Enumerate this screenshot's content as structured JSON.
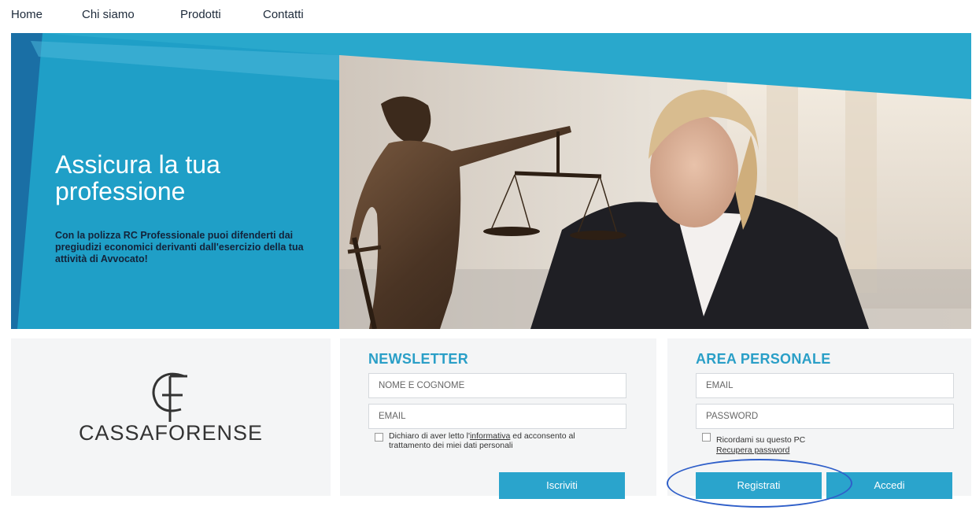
{
  "nav": {
    "home": "Home",
    "about": "Chi siamo",
    "products": "Prodotti",
    "contacts": "Contatti"
  },
  "hero": {
    "title": "Assicura la tua professione",
    "subtitle": "Con la polizza RC Professionale puoi difenderti dai pregiudizi economici derivanti dall'esercizio della tua attività di Avvocato!"
  },
  "logo": {
    "mark": "CF",
    "name": "CASSAFORENSE"
  },
  "newsletter": {
    "title": "NEWSLETTER",
    "name_placeholder": "NOME E COGNOME",
    "email_placeholder": "EMAIL",
    "consent_before": "Dichiaro di aver letto l'",
    "consent_link": "informativa",
    "consent_after": " ed acconsento al trattamento dei miei dati personali",
    "submit": "Iscriviti"
  },
  "personal_area": {
    "title": "AREA PERSONALE",
    "email_placeholder": "EMAIL",
    "password_placeholder": "PASSWORD",
    "remember": "Ricordami su questo PC",
    "recover": "Recupera password",
    "register": "Registrati",
    "login": "Accedi"
  },
  "colors": {
    "accent": "#2aa4cc",
    "heading": "#2a9fc7",
    "annotation": "#2f5fc9"
  }
}
